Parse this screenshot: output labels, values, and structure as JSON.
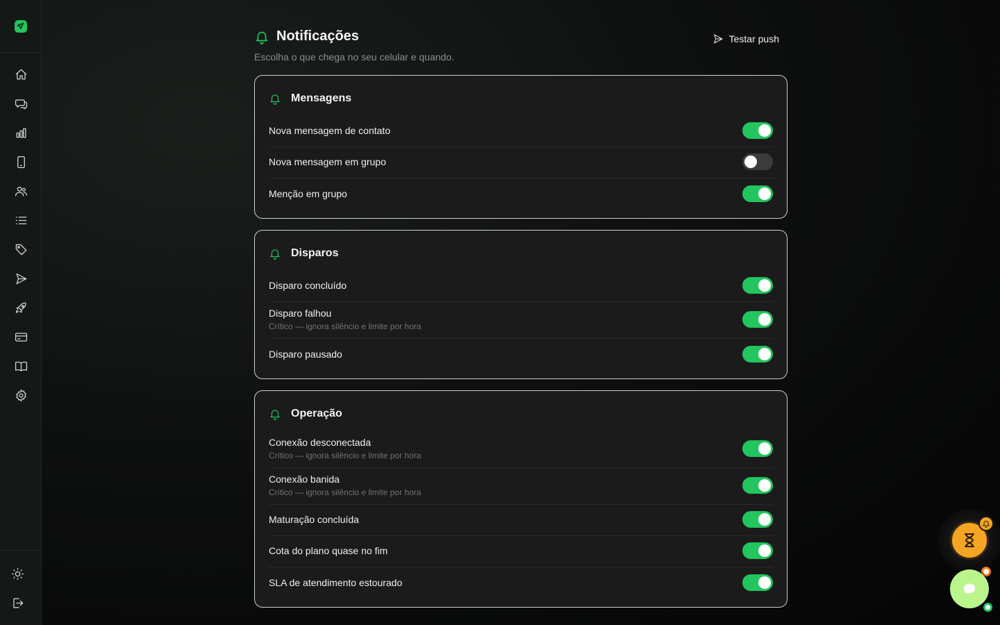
{
  "brand": {
    "accent": "#22c55e",
    "logo_icon": "send-logo-icon"
  },
  "sidebar": {
    "items": [
      {
        "name": "home",
        "icon": "home-icon"
      },
      {
        "name": "chats",
        "icon": "chat-bubbles-icon"
      },
      {
        "name": "reports",
        "icon": "bar-chart-icon"
      },
      {
        "name": "devices",
        "icon": "smartphone-icon"
      },
      {
        "name": "contacts",
        "icon": "users-icon"
      },
      {
        "name": "lists",
        "icon": "list-icon"
      },
      {
        "name": "tags",
        "icon": "tag-icon"
      },
      {
        "name": "campaigns",
        "icon": "send-icon"
      },
      {
        "name": "warmup",
        "icon": "rocket-icon"
      },
      {
        "name": "billing",
        "icon": "credit-card-icon"
      },
      {
        "name": "docs",
        "icon": "book-icon"
      },
      {
        "name": "settings",
        "icon": "gear-icon"
      }
    ],
    "bottom": [
      {
        "name": "theme",
        "icon": "sun-icon"
      },
      {
        "name": "logout",
        "icon": "logout-icon"
      }
    ]
  },
  "header": {
    "title": "Notificações",
    "subtitle": "Escolha o que chega no seu celular e quando.",
    "test_push_label": "Testar push"
  },
  "sections": [
    {
      "title": "Mensagens",
      "items": [
        {
          "label": "Nova mensagem de contato",
          "hint": "",
          "enabled": true
        },
        {
          "label": "Nova mensagem em grupo",
          "hint": "",
          "enabled": false
        },
        {
          "label": "Menção em grupo",
          "hint": "",
          "enabled": true
        }
      ]
    },
    {
      "title": "Disparos",
      "items": [
        {
          "label": "Disparo concluído",
          "hint": "",
          "enabled": true
        },
        {
          "label": "Disparo falhou",
          "hint": "Crítico — ignora silêncio e limite por hora",
          "enabled": true
        },
        {
          "label": "Disparo pausado",
          "hint": "",
          "enabled": true
        }
      ]
    },
    {
      "title": "Operação",
      "items": [
        {
          "label": "Conexão desconectada",
          "hint": "Crítico — ignora silêncio e limite por hora",
          "enabled": true
        },
        {
          "label": "Conexão banida",
          "hint": "Crítico — ignora silêncio e limite por hora",
          "enabled": true
        },
        {
          "label": "Maturação concluída",
          "hint": "",
          "enabled": true
        },
        {
          "label": "Cota do plano quase no fim",
          "hint": "",
          "enabled": true
        },
        {
          "label": "SLA de atendimento estourado",
          "hint": "",
          "enabled": true
        }
      ]
    }
  ],
  "floating": {
    "timer_icon": "hourglass-icon",
    "badge_icon": "bell-icon",
    "chat_icon": "chat-bubble-icon"
  }
}
